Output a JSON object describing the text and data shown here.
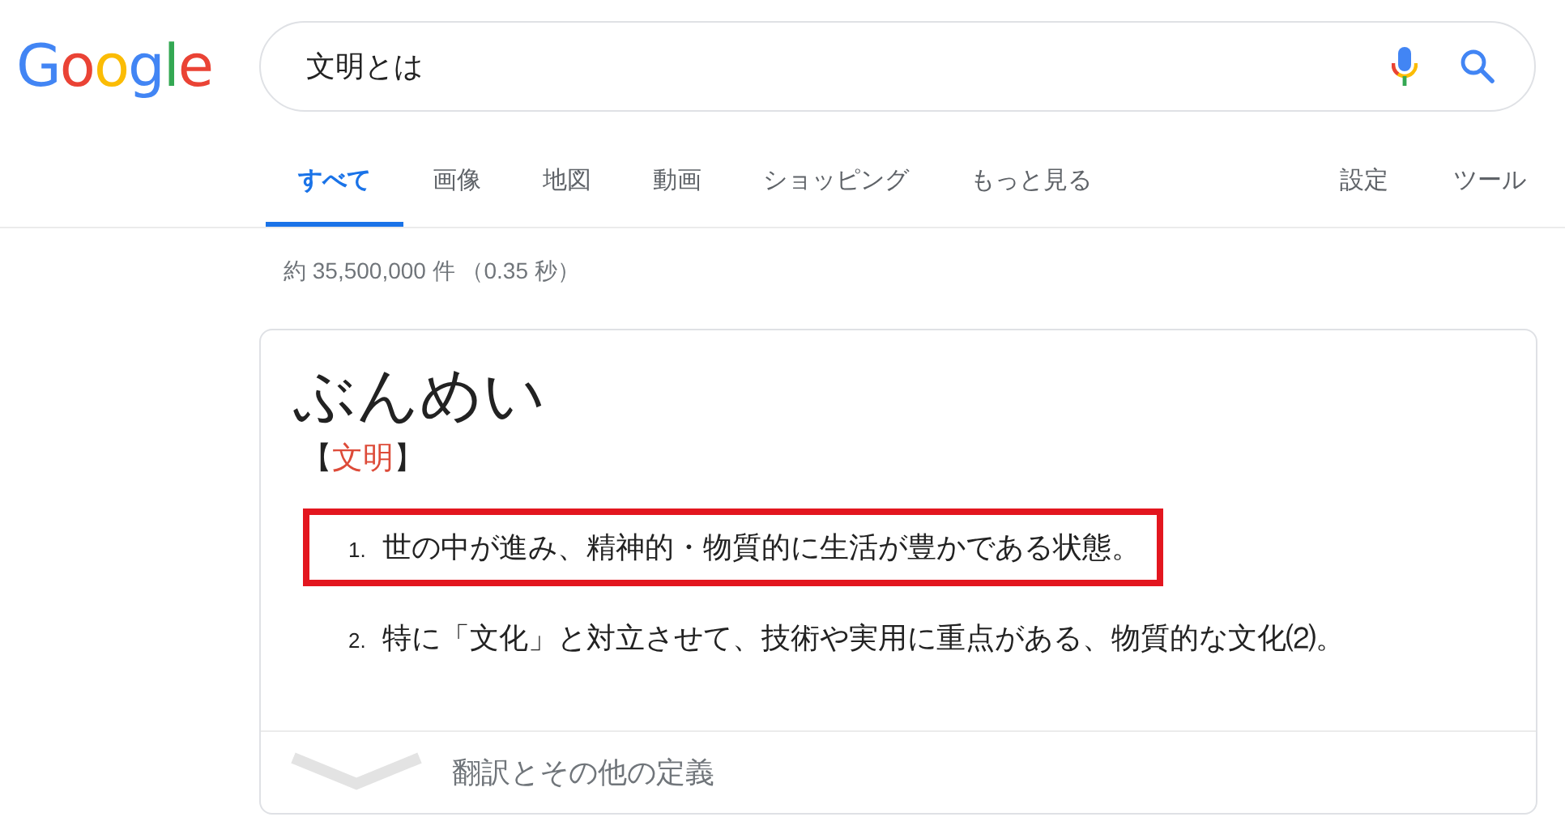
{
  "logo": "Google",
  "search": {
    "value": "文明とは"
  },
  "tabs": [
    {
      "label": "すべて",
      "selected": true
    },
    {
      "label": "画像",
      "selected": false
    },
    {
      "label": "地図",
      "selected": false
    },
    {
      "label": "動画",
      "selected": false
    },
    {
      "label": "ショッピング",
      "selected": false
    },
    {
      "label": "もっと見る",
      "selected": false
    }
  ],
  "tools": [
    "設定",
    "ツール"
  ],
  "result_stats": "約 35,500,000 件 （0.35 秒）",
  "dictionary": {
    "reading": "ぶんめい",
    "headword": {
      "open": "【",
      "text": "文明",
      "close": "】"
    },
    "definitions": [
      {
        "number": "1.",
        "text": "世の中が進み、精神的・物質的に生活が豊かである状態。",
        "highlighted": true
      },
      {
        "number": "2.",
        "text": "特に「文化」と対立させて、技術や実用に重点がある、物質的な文化⑵。",
        "highlighted": false
      }
    ],
    "more": "翻訳とその他の定義"
  }
}
